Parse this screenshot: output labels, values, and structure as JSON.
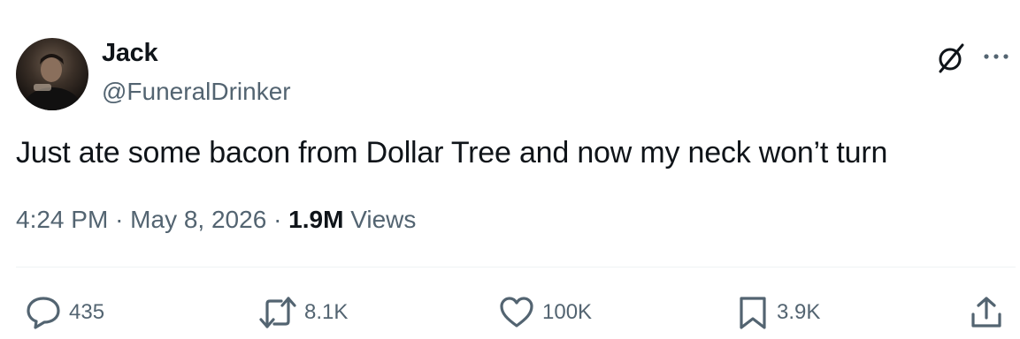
{
  "author": {
    "name": "Jack",
    "handle": "@FuneralDrinker"
  },
  "tweet": {
    "text": "Just ate some bacon from Dollar Tree and now my neck won’t turn",
    "time": "4:24 PM",
    "date": "May 8, 2026",
    "views_count": "1.9M",
    "views_label": "Views",
    "separator": "·"
  },
  "actions": {
    "replies": "435",
    "reposts": "8.1K",
    "likes": "100K",
    "bookmarks": "3.9K"
  },
  "icons": {
    "header": [
      "grok-icon",
      "more-icon"
    ],
    "actions": [
      "reply-icon",
      "repost-icon",
      "like-icon",
      "bookmark-icon",
      "share-icon"
    ]
  },
  "colors": {
    "text_primary": "#0f1419",
    "text_secondary": "#536471",
    "divider": "#eff3f4"
  }
}
